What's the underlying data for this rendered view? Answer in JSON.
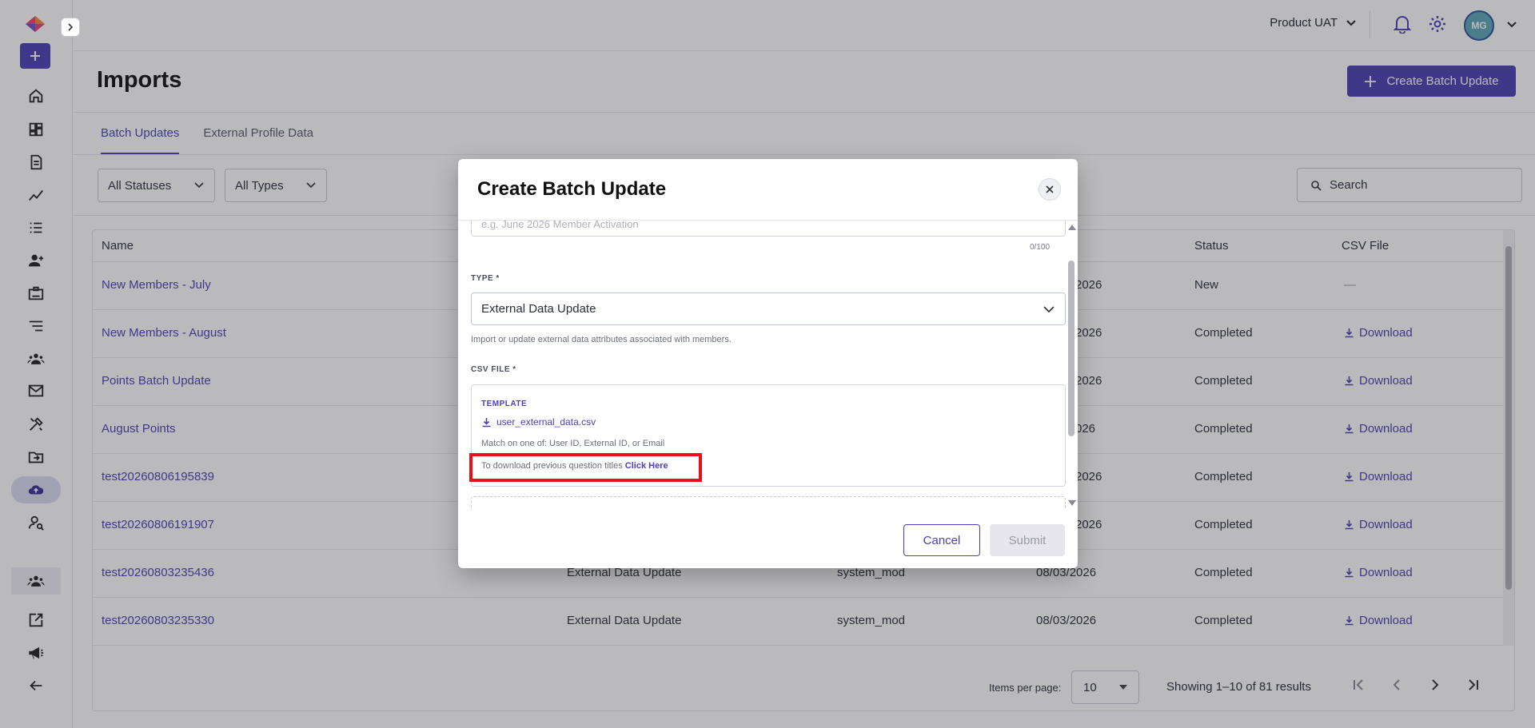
{
  "topbar": {
    "environment": "Product UAT",
    "avatar_initials": "MG"
  },
  "page": {
    "title": "Imports",
    "create_button": "Create Batch Update"
  },
  "tabs": [
    {
      "label": "Batch Updates"
    },
    {
      "label": "External Profile Data"
    }
  ],
  "filters": {
    "status": "All Statuses",
    "type": "All Types",
    "search_placeholder": "Search"
  },
  "table": {
    "headers": {
      "name": "Name",
      "status": "Status",
      "csv": "CSV File"
    },
    "rows": [
      {
        "name": "New Members - July",
        "type": "",
        "user": "",
        "date": "2026",
        "status": "New",
        "csv": "—"
      },
      {
        "name": "New Members - August",
        "type": "",
        "user": "",
        "date": "2026",
        "status": "Completed",
        "csv": "Download"
      },
      {
        "name": "Points Batch Update",
        "type": "",
        "user": "",
        "date": "2026",
        "status": "Completed",
        "csv": "Download"
      },
      {
        "name": "August Points",
        "type": "",
        "user": "",
        "date": "026",
        "status": "Completed",
        "csv": "Download"
      },
      {
        "name": "test20260806195839",
        "type": "",
        "user": "",
        "date": "2026",
        "status": "Completed",
        "csv": "Download"
      },
      {
        "name": "test20260806191907",
        "type": "",
        "user": "",
        "date": "2026",
        "status": "Completed",
        "csv": "Download"
      },
      {
        "name": "test20260803235436",
        "type": "External Data Update",
        "user": "system_mod",
        "date": "08/03/2026",
        "status": "Completed",
        "csv": "Download"
      },
      {
        "name": "test20260803235330",
        "type": "External Data Update",
        "user": "system_mod",
        "date": "08/03/2026",
        "status": "Completed",
        "csv": "Download"
      }
    ],
    "pagination": {
      "items_per_page_label": "Items per page:",
      "items_per_page": "10",
      "showing": "Showing 1–10 of 81 results"
    }
  },
  "modal": {
    "title": "Create Batch Update",
    "name_placeholder": "e.g. June 2026 Member Activation",
    "name_counter": "0/100",
    "type_label": "TYPE *",
    "type_value": "External Data Update",
    "type_hint": "Import or update external data attributes associated with members.",
    "csv_label": "CSV FILE *",
    "template_label": "TEMPLATE",
    "template_file": "user_external_data.csv",
    "match_hint": "Match on one of: User ID, External ID, or Email",
    "prev_questions_text": "To download previous question titles",
    "prev_questions_link": "Click Here",
    "cancel": "Cancel",
    "submit": "Submit"
  },
  "colors": {
    "accent": "#4b3fb3",
    "highlight": "#e5101b"
  },
  "icons": [
    "app-logo-icon",
    "chevron-right-icon",
    "plus-icon",
    "home-icon",
    "dashboard-icon",
    "document-icon",
    "analytics-icon",
    "list-icon",
    "add-user-icon",
    "badge-icon",
    "menu-icon",
    "group-icon",
    "mail-icon",
    "tools-icon",
    "folder-import-icon",
    "cloud-upload-icon",
    "user-search-icon",
    "team-icon",
    "external-link-icon",
    "megaphone-icon",
    "back-arrow-icon",
    "bell-icon",
    "gear-icon",
    "chevron-down-icon",
    "search-icon",
    "download-icon",
    "close-icon"
  ]
}
